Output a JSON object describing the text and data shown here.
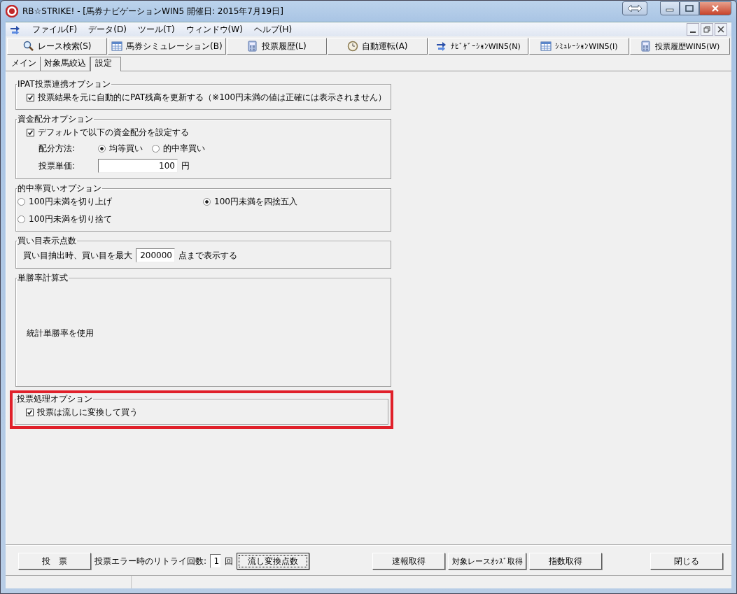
{
  "window": {
    "title": "RB☆STRIKE! - [馬券ナビゲーションWIN5  開催日: 2015年7月19日]"
  },
  "menu": [
    "ファイル(F)",
    "データ(D)",
    "ツール(T)",
    "ウィンドウ(W)",
    "ヘルプ(H)"
  ],
  "toolbar": [
    {
      "label": "レース検索(S)",
      "kind": "search"
    },
    {
      "label": "馬券シミュレーション(B)",
      "kind": "table"
    },
    {
      "label": "投票履歴(L)",
      "kind": "calculator"
    },
    {
      "label": "自動運転(A)",
      "kind": "clock"
    },
    {
      "label": "ﾅﾋﾞｹﾞｰｼｮﾝWIN5(N)",
      "kind": "arrows"
    },
    {
      "label": "ｼﾐｭﾚｰｼｮﾝWIN5(I)",
      "kind": "table"
    },
    {
      "label": "投票履歴WIN5(W)",
      "kind": "calculator"
    }
  ],
  "tabs": [
    {
      "label": "メイン",
      "selected": false
    },
    {
      "label": "対象馬絞込",
      "selected": false
    },
    {
      "label": "設定",
      "selected": true
    }
  ],
  "groups": [
    {
      "title": "IPAT投票連携オプション",
      "highlighted": false,
      "items": [
        {
          "kind": "checkbox",
          "label": "投票結果を元に自動的にPAT残高を更新する（※100円未満の値は正確には表示されません）",
          "checked": true
        }
      ]
    },
    {
      "title": "資金配分オプション",
      "highlighted": false,
      "items": [
        {
          "kind": "checkbox",
          "label": "デフォルトで以下の資金配分を設定する",
          "checked": true
        },
        {
          "kind": "radio_row",
          "label": "配分方法:",
          "options": [
            {
              "label": "均等買い",
              "selected": true
            },
            {
              "label": "的中率買い",
              "selected": false
            }
          ]
        },
        {
          "kind": "field",
          "label": "投票単価:",
          "value": "100",
          "unit": "円"
        }
      ]
    },
    {
      "title": "的中率買いオプション",
      "highlighted": false,
      "items": [
        {
          "kind": "radio_grid",
          "options": [
            {
              "label": "100円未満を切り上げ",
              "selected": false
            },
            {
              "label": "100円未満を四捨五入",
              "selected": true
            },
            {
              "label": "100円未満を切り捨て",
              "selected": false
            }
          ]
        }
      ]
    },
    {
      "title": "買い目表示点数",
      "highlighted": false,
      "items": [
        {
          "kind": "inline_field",
          "before": "買い目抽出時、買い目を最大",
          "value": "200000",
          "after": "点まで表示する"
        }
      ]
    },
    {
      "title": "単勝率計算式",
      "highlighted": false,
      "items": [
        {
          "kind": "text",
          "text": "統計単勝率を使用"
        }
      ]
    },
    {
      "title": "投票処理オプション",
      "highlighted": true,
      "items": [
        {
          "kind": "checkbox",
          "label": "投票は流しに変換して買う",
          "checked": true
        }
      ]
    }
  ],
  "bottom_bar": {
    "left": [
      {
        "kind": "button",
        "label": "投　票",
        "focused": false
      },
      {
        "kind": "label",
        "label": "投票エラー時のリトライ回数:"
      },
      {
        "kind": "field",
        "value": "1"
      },
      {
        "kind": "label",
        "label": "回"
      },
      {
        "kind": "button",
        "label": "流し変換点数",
        "focused": true
      }
    ],
    "middle": [
      {
        "kind": "button",
        "label": "速報取得",
        "focused": false
      },
      {
        "kind": "button",
        "label": "対象レースｵｯｽﾞ取得",
        "focused": false
      },
      {
        "kind": "button",
        "label": "指数取得",
        "focused": false
      }
    ],
    "right": [
      {
        "kind": "button",
        "label": "閉じる",
        "focused": false
      }
    ]
  }
}
